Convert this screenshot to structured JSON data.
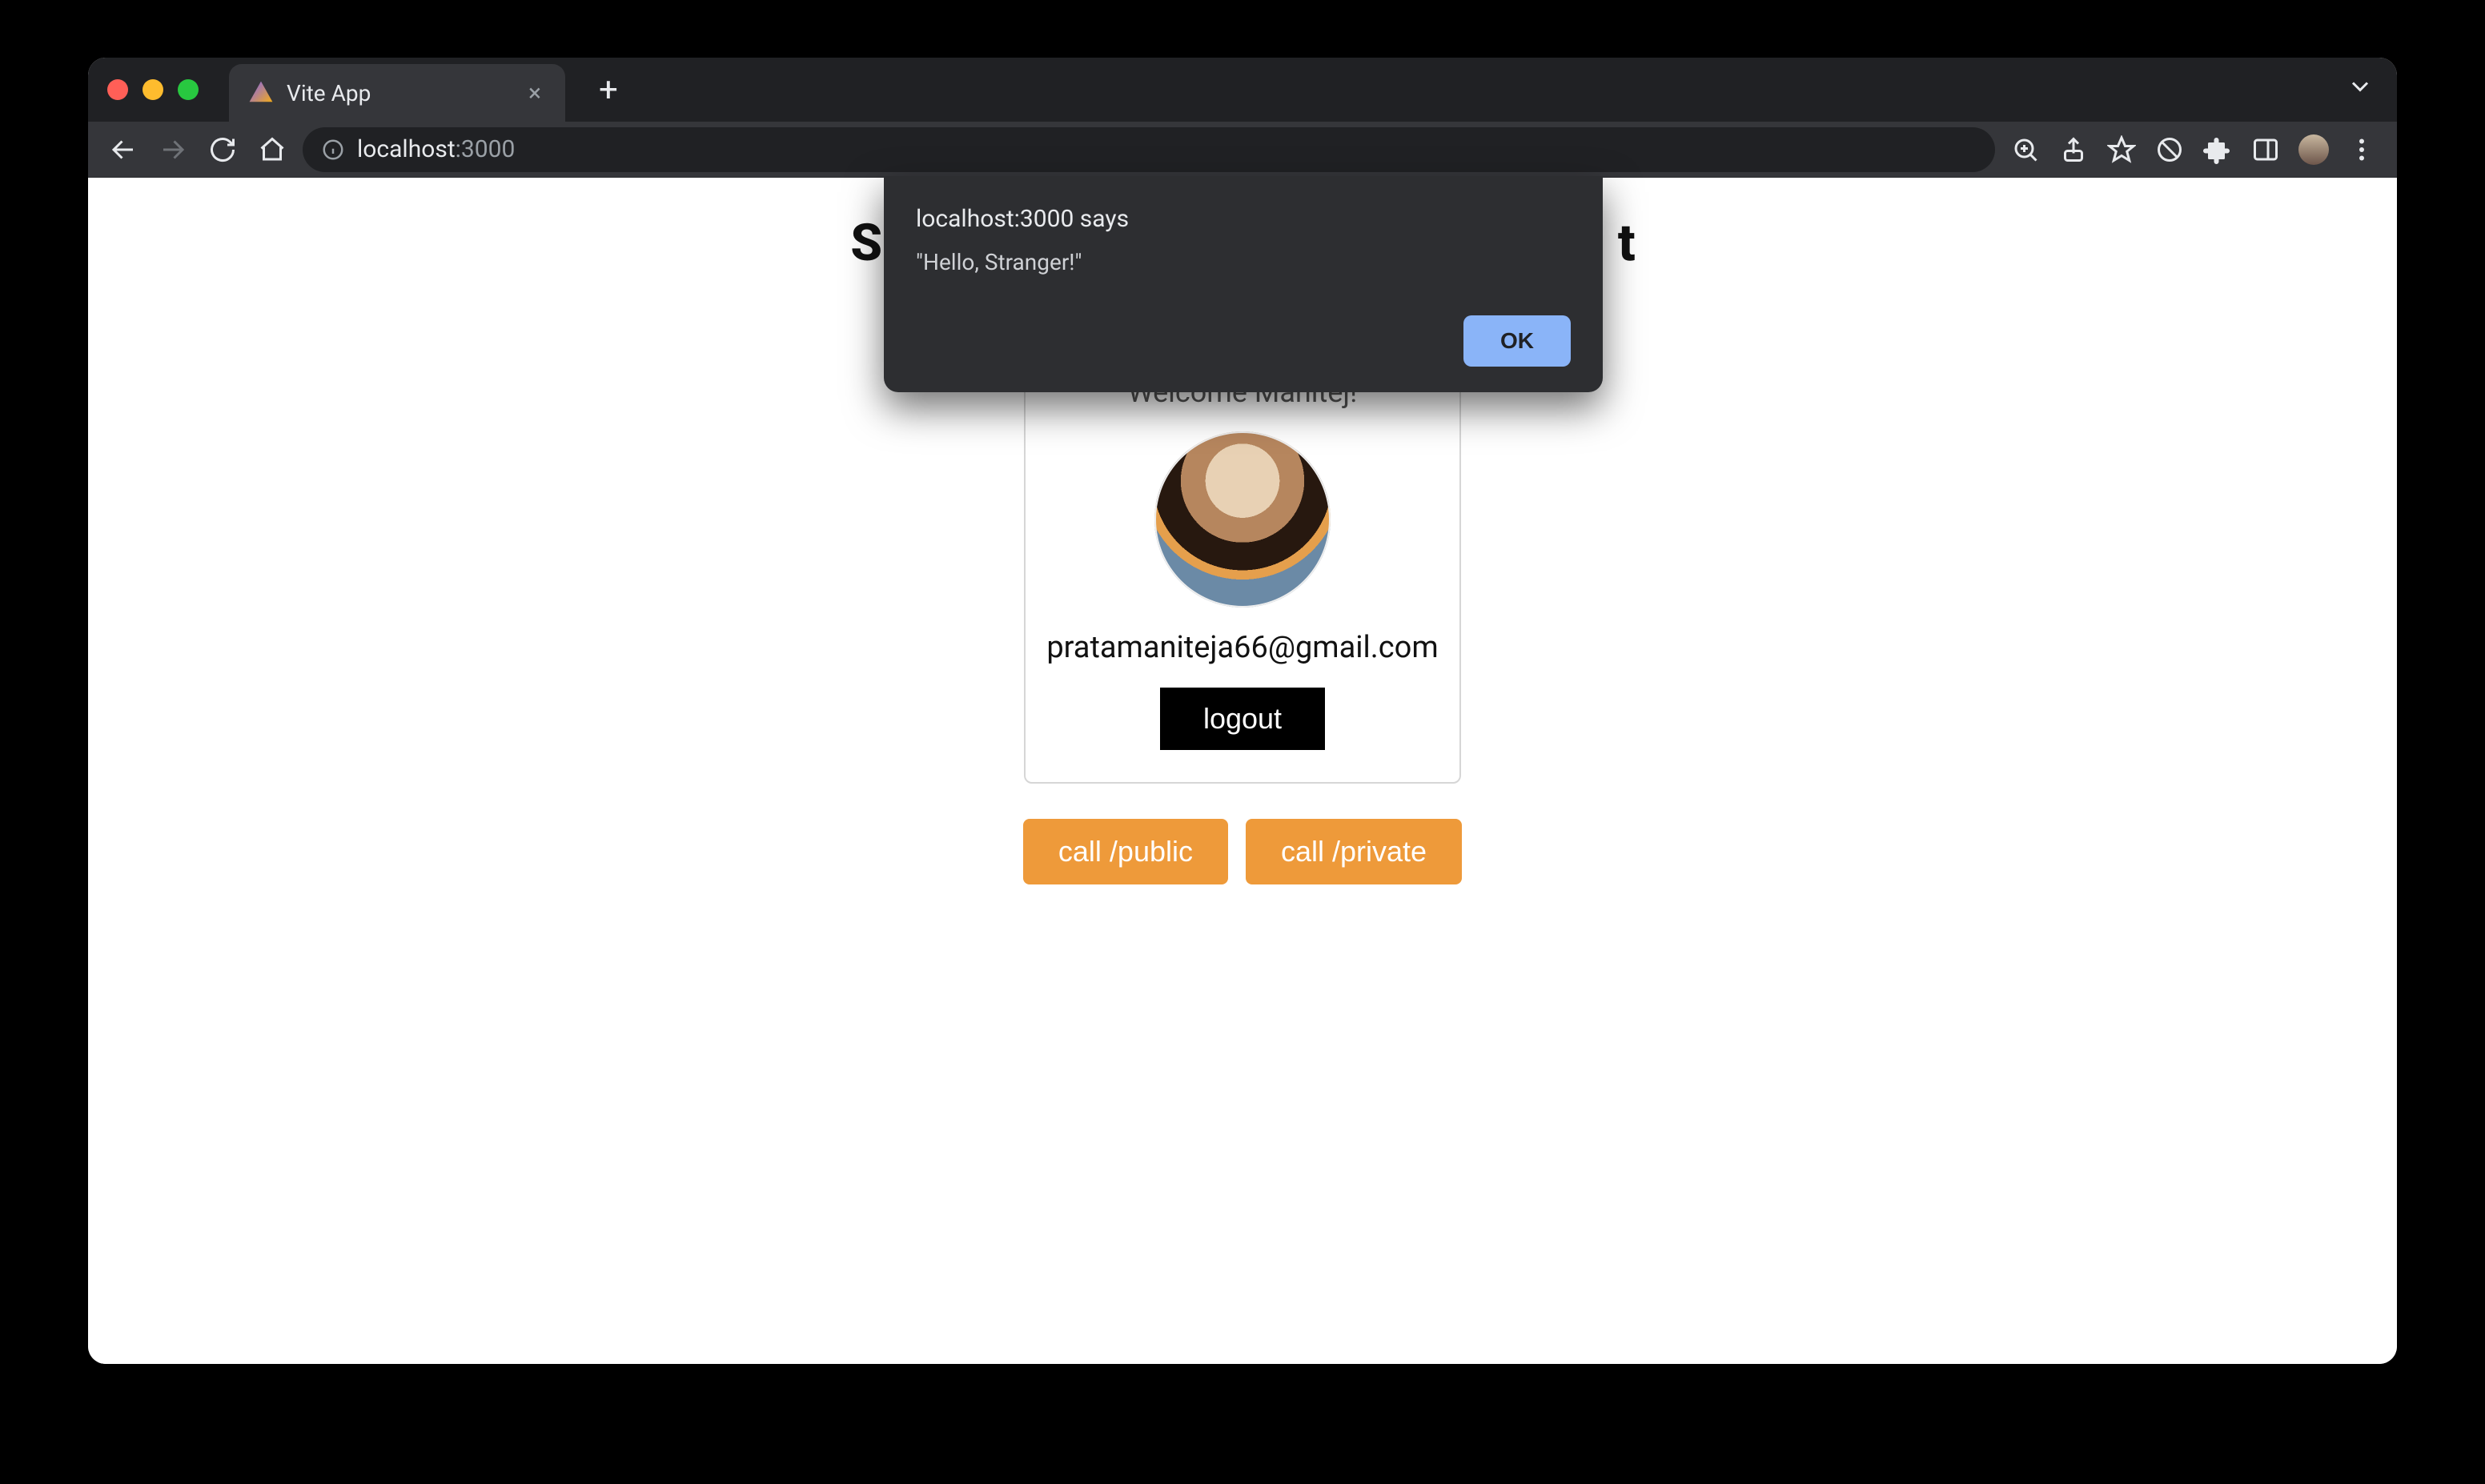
{
  "browser": {
    "tab_title": "Vite App",
    "url_host": "localhost",
    "url_path": ":3000"
  },
  "alert": {
    "title": "localhost:3000 says",
    "message": "\"Hello, Stranger!\"",
    "ok_label": "OK"
  },
  "page": {
    "heading_prefix": "S",
    "heading_suffix": "t",
    "card": {
      "welcome": "Welcome Manitej!",
      "email": "pratamaniteja66@gmail.com",
      "logout_label": "logout"
    },
    "buttons": {
      "call_public": "call /public",
      "call_private": "call /private"
    }
  }
}
